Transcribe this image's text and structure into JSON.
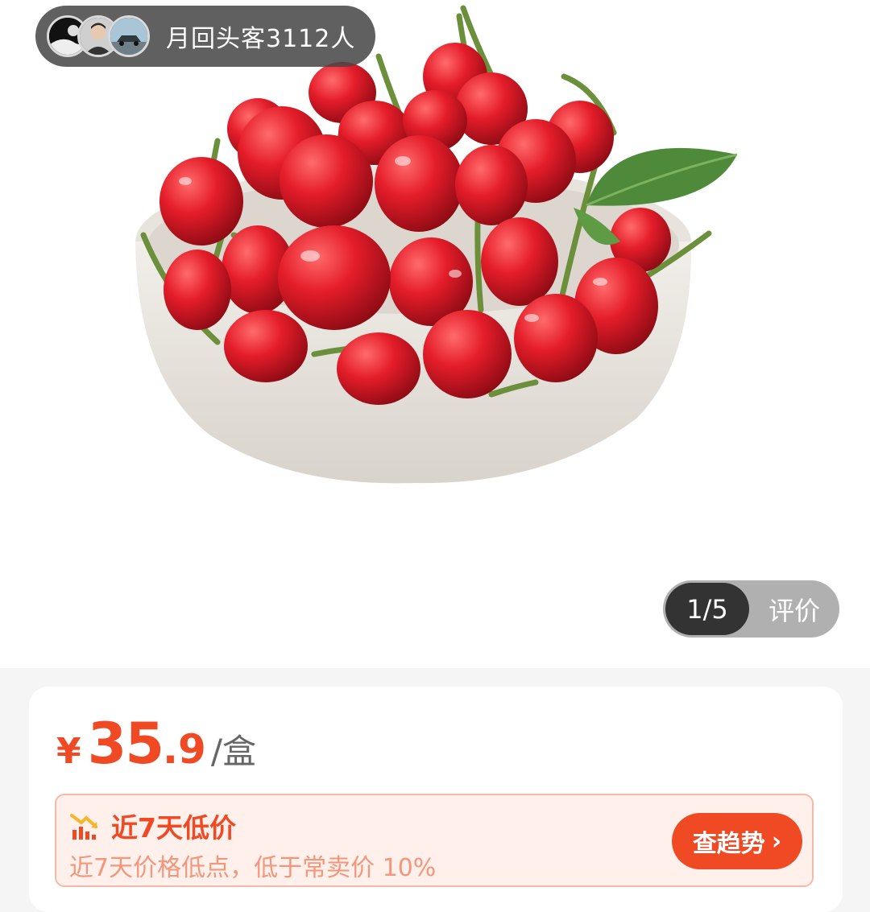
{
  "badge": {
    "repeat_customers": "月回头客3112人"
  },
  "gallery": {
    "index": "1/5",
    "reviews_label": "评价"
  },
  "product": {
    "currency": "¥",
    "price_int": "35",
    "price_dec": ".9",
    "unit": "/盒"
  },
  "trend": {
    "title": "近7天低价",
    "description": "近7天价格低点，低于常卖价 10%",
    "button_label": "查趋势",
    "button_chevron": "›"
  },
  "colors": {
    "accent": "#f04a25",
    "accent_light": "#fff0ec",
    "pill_bg": "#464646"
  }
}
